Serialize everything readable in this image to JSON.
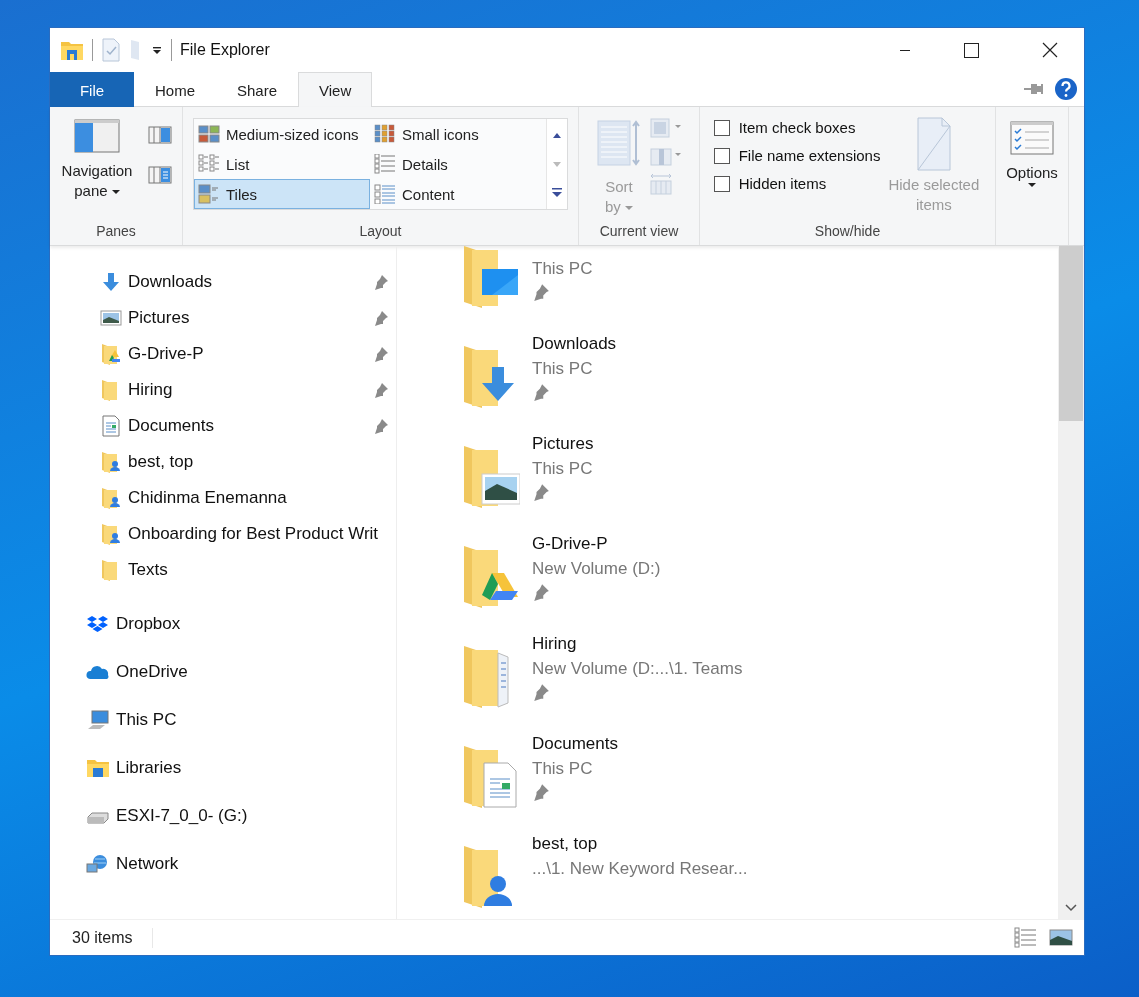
{
  "window": {
    "title": "File Explorer"
  },
  "tabs": [
    {
      "label": "File",
      "kind": "file",
      "selected": false
    },
    {
      "label": "Home",
      "kind": "tab",
      "selected": false
    },
    {
      "label": "Share",
      "kind": "tab",
      "selected": false
    },
    {
      "label": "View",
      "kind": "tab",
      "selected": true
    }
  ],
  "ribbon": {
    "panes": {
      "label": "Panes",
      "navigation_pane": [
        "Navigation",
        "pane"
      ]
    },
    "layout": {
      "label": "Layout",
      "options": [
        {
          "label": "Medium-sized icons",
          "kind": "medium",
          "selected": false
        },
        {
          "label": "Small icons",
          "kind": "small",
          "selected": false
        },
        {
          "label": "List",
          "kind": "list",
          "selected": false
        },
        {
          "label": "Details",
          "kind": "details",
          "selected": false
        },
        {
          "label": "Tiles",
          "kind": "tiles",
          "selected": true
        },
        {
          "label": "Content",
          "kind": "content",
          "selected": false
        }
      ]
    },
    "current_view": {
      "label": "Current view",
      "sort_by": [
        "Sort",
        "by"
      ],
      "disabled": true
    },
    "show_hide": {
      "label": "Show/hide",
      "checkboxes": [
        {
          "label": "Item check boxes",
          "checked": false
        },
        {
          "label": "File name extensions",
          "checked": false
        },
        {
          "label": "Hidden items",
          "checked": false
        }
      ],
      "hide_selected": [
        "Hide selected",
        "items"
      ],
      "hide_selected_disabled": true
    },
    "options": {
      "label": "Options"
    }
  },
  "nav_pane": {
    "quick_access_children": [
      {
        "name": "Downloads",
        "kind": "downloads",
        "pinned": true
      },
      {
        "name": "Pictures",
        "kind": "pictures",
        "pinned": true
      },
      {
        "name": "G-Drive-P",
        "kind": "gdrive",
        "pinned": true
      },
      {
        "name": "Hiring",
        "kind": "folder",
        "pinned": true
      },
      {
        "name": "Documents",
        "kind": "documents",
        "pinned": true
      },
      {
        "name": "best, top",
        "kind": "shared",
        "pinned": false
      },
      {
        "name": "Chidinma Enemanna",
        "kind": "shared",
        "pinned": false
      },
      {
        "name": "Onboarding for Best Product Writ",
        "kind": "shared",
        "pinned": false
      },
      {
        "name": "Texts",
        "kind": "folder",
        "pinned": false
      }
    ],
    "locations": [
      {
        "name": "Dropbox",
        "kind": "dropbox"
      },
      {
        "name": "OneDrive",
        "kind": "onedrive"
      },
      {
        "name": "This PC",
        "kind": "pc"
      },
      {
        "name": "Libraries",
        "kind": "libraries"
      },
      {
        "name": "ESXI-7_0_0- (G:)",
        "kind": "drive"
      },
      {
        "name": "Network",
        "kind": "network"
      }
    ]
  },
  "tiles": [
    {
      "location": "This PC",
      "kind": "desktop",
      "pinned": true
    },
    {
      "name": "Downloads",
      "location": "This PC",
      "kind": "downloads",
      "pinned": true
    },
    {
      "name": "Pictures",
      "location": "This PC",
      "kind": "pictures",
      "pinned": true
    },
    {
      "name": "G-Drive-P",
      "location": "New Volume (D:)",
      "kind": "gdrive",
      "pinned": true
    },
    {
      "name": "Hiring",
      "location": "New Volume (D:...\\1. Teams",
      "kind": "hiring",
      "pinned": true
    },
    {
      "name": "Documents",
      "location": "This PC",
      "kind": "documents",
      "pinned": true
    },
    {
      "name": "best, top",
      "location": "...\\1. New Keyword Resear...",
      "kind": "shared",
      "pinned": false
    }
  ],
  "status_bar": {
    "item_count": "30 items"
  }
}
